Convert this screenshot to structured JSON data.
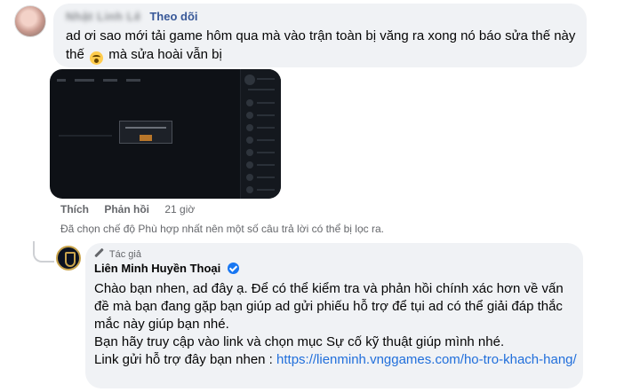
{
  "comment": {
    "author_name": "Nhật Linh Lê",
    "follow_label": "Theo dõi",
    "text_before_emoji": "ad ơi sao mới tải game hôm qua mà vào trận toàn bị văng ra xong nó báo sửa thế này thế",
    "emoji": "crying-face",
    "text_after_emoji": "mà sửa hoài vẫn bị",
    "actions": {
      "like": "Thích",
      "reply": "Phản hồi",
      "time": "21 giờ"
    }
  },
  "filter_note": "Đã chọn chế độ Phù hợp nhất nên một số câu trả lời có thể bị lọc ra.",
  "reply": {
    "badge": "Tác giả",
    "author_name": "Liên Minh Huyền Thoại",
    "paragraphs": [
      "Chào bạn nhen, ad đây ạ. Để có thể kiểm tra và phản hồi chính xác hơn về vấn đề mà bạn đang gặp bạn giúp ad gửi phiếu hỗ trợ để tụi ad có thể giải đáp thắc mắc này giúp bạn nhé.",
      "Bạn hãy truy cập vào link và chọn mục Sự cố kỹ thuật giúp mình nhé."
    ],
    "link_prefix": "Link gửi hỗ trợ đây bạn nhen : ",
    "link_text": "https://lienminh.vnggames.com/ho-tro-khach-hang/"
  },
  "colors": {
    "bubble": "#f0f2f5",
    "link": "#216fdb",
    "follow": "#385898",
    "verified": "#1877f2"
  }
}
